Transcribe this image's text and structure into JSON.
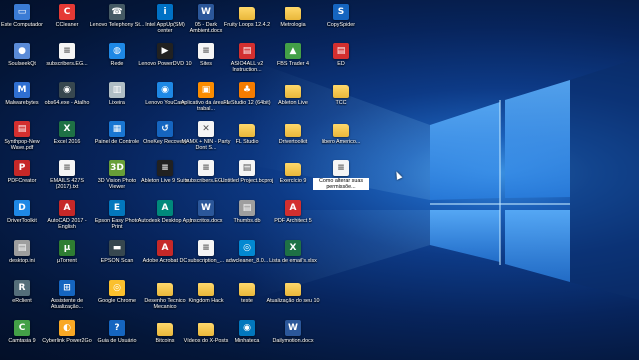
{
  "desktop": {
    "columns": [
      [
        {
          "label": "Este Computador",
          "icon": "computer-icon",
          "color": "#3a7bd5",
          "glyph": "▭"
        },
        {
          "label": "SoulseekQt",
          "icon": "soulseek-icon",
          "color": "#5a8bd8",
          "glyph": "●"
        },
        {
          "label": "Malwarebytes",
          "icon": "malwarebytes-icon",
          "color": "#2f6fd1",
          "glyph": "M"
        },
        {
          "label": "Synthpop-New Wave.pdf",
          "icon": "pdf-icon",
          "color": "#d32f2f",
          "glyph": "▤"
        },
        {
          "label": "PDFCreator",
          "icon": "pdfcreator-icon",
          "color": "#c62828",
          "glyph": "P"
        },
        {
          "label": "DriverToolkit",
          "icon": "drivertoolkit-icon",
          "color": "#1e88e5",
          "glyph": "D"
        },
        {
          "label": "desktop.ini",
          "icon": "ini-file-icon",
          "color": "#9e9e9e",
          "glyph": "▤"
        },
        {
          "label": "eRclient",
          "icon": "erclient-icon",
          "color": "#546e7a",
          "glyph": "R"
        },
        {
          "label": "Camtasia 9",
          "icon": "camtasia-icon",
          "color": "#43a047",
          "glyph": "C"
        }
      ],
      [
        {
          "label": "CCleaner",
          "icon": "ccleaner-icon",
          "color": "#e53935",
          "glyph": "C"
        },
        {
          "label": "subscribers.EG...",
          "icon": "text-file-icon",
          "color": "#eceff1",
          "glyph": "≡"
        },
        {
          "label": "obs64.exe - Atalho",
          "icon": "obs-icon",
          "color": "#37474f",
          "glyph": "◉"
        },
        {
          "label": "Excel 2016",
          "icon": "excel-icon",
          "color": "#1e7145",
          "glyph": "X"
        },
        {
          "label": "EMAILS 427S (2017).txt",
          "icon": "text-file-icon",
          "color": "#eceff1",
          "glyph": "≡"
        },
        {
          "label": "AutoCAD 2017 - English",
          "icon": "autocad-icon",
          "color": "#c62828",
          "glyph": "A"
        },
        {
          "label": "µTorrent",
          "icon": "utorrent-icon",
          "color": "#2e7d32",
          "glyph": "µ"
        },
        {
          "label": "Assistente de Atualização...",
          "icon": "windows-update-icon",
          "color": "#1565c0",
          "glyph": "⊞"
        },
        {
          "label": "Cyberlink Power2Go",
          "icon": "power2go-icon",
          "color": "#f9a825",
          "glyph": "◐"
        }
      ],
      [
        {
          "label": "Lenovo Telephony St...",
          "icon": "lenovo-telephony-icon",
          "color": "#455a64",
          "glyph": "☎"
        },
        {
          "label": "Rede",
          "icon": "network-icon",
          "color": "#1e88e5",
          "glyph": "◍"
        },
        {
          "label": "Lixeira",
          "icon": "recycle-bin-icon",
          "color": "#b0bec5",
          "glyph": "▥"
        },
        {
          "label": "Painel de Controle",
          "icon": "control-panel-icon",
          "color": "#1976d2",
          "glyph": "▦"
        },
        {
          "label": "3D Vision Photo Viewer",
          "icon": "3d-vision-icon",
          "color": "#689f38",
          "glyph": "3D"
        },
        {
          "label": "Epson Easy Photo Print",
          "icon": "epson-photo-icon",
          "color": "#0277bd",
          "glyph": "E"
        },
        {
          "label": "EPSON Scan",
          "icon": "epson-scan-icon",
          "color": "#37474f",
          "glyph": "▬"
        },
        {
          "label": "Google Chrome",
          "icon": "chrome-icon",
          "color": "#fbc02d",
          "glyph": "◎"
        },
        {
          "label": "Guia de Usuário",
          "icon": "guide-icon",
          "color": "#1565c0",
          "glyph": "?"
        }
      ],
      [
        {
          "label": "Intel AppUp(SM) center",
          "icon": "intel-appup-icon",
          "color": "#0071c5",
          "glyph": "i"
        },
        {
          "label": "Lenovo PowerDVD 10",
          "icon": "powerdvd-icon",
          "color": "#212121",
          "glyph": "▶"
        },
        {
          "label": "Lenovo YouCam",
          "icon": "youcam-icon",
          "color": "#1e88e5",
          "glyph": "◉"
        },
        {
          "label": "OneKey Recovery",
          "icon": "onekey-icon",
          "color": "#1565c0",
          "glyph": "↺"
        },
        {
          "label": "Ableton Live 9 Suite",
          "icon": "ableton-icon",
          "color": "#212121",
          "glyph": "≡"
        },
        {
          "label": "Autodesk Desktop App",
          "icon": "autodesk-icon",
          "color": "#00897b",
          "glyph": "A"
        },
        {
          "label": "Adobe Acrobat DC",
          "icon": "acrobat-icon",
          "color": "#c62828",
          "glyph": "A"
        },
        {
          "label": "Desenho Tecnico Mecanico",
          "icon": "folder-icon",
          "color": "#f4c542",
          "glyph": ""
        },
        {
          "label": "Bitcoins",
          "icon": "folder-icon",
          "color": "#f4c542",
          "glyph": ""
        }
      ],
      [
        {
          "label": "05 - Dark Ambient.docx",
          "icon": "word-doc-icon",
          "color": "#2b579a",
          "glyph": "W"
        },
        {
          "label": "Sites",
          "icon": "text-file-icon",
          "color": "#eceff1",
          "glyph": "≡"
        },
        {
          "label": "Aplicativo da área de trabal...",
          "icon": "app-icon",
          "color": "#fb8c00",
          "glyph": "▣"
        },
        {
          "label": "MAMX + NIN - Party Dont S...",
          "icon": "document-icon",
          "color": "#eceff1",
          "glyph": "✕"
        },
        {
          "label": "subscribers.EG...",
          "icon": "text-file-icon",
          "color": "#eceff1",
          "glyph": "≡"
        },
        {
          "label": "Inscritos.docx",
          "icon": "word-doc-icon",
          "color": "#2b579a",
          "glyph": "W"
        },
        {
          "label": "subscription_...",
          "icon": "text-file-icon",
          "color": "#eceff1",
          "glyph": "≡"
        },
        {
          "label": "Kingdom Hack",
          "icon": "folder-icon",
          "color": "#f4c542",
          "glyph": ""
        },
        {
          "label": "Vídeos do X-Posts",
          "icon": "folder-icon",
          "color": "#f4c542",
          "glyph": ""
        }
      ],
      [
        {
          "label": "Fruity Loops 12.4.2",
          "icon": "folder-icon",
          "color": "#f4c542",
          "glyph": ""
        },
        {
          "label": "ASIO4ALL v2 Instruction...",
          "icon": "pdf-icon",
          "color": "#d32f2f",
          "glyph": "▤"
        },
        {
          "label": "FL Studio 12 (64bit)",
          "icon": "fl-studio-icon",
          "color": "#f57c00",
          "glyph": "♣"
        },
        {
          "label": "FL Studio",
          "icon": "folder-icon",
          "color": "#f4c542",
          "glyph": ""
        },
        {
          "label": "Untitled Project.bcproj",
          "icon": "project-file-icon",
          "color": "#eceff1",
          "glyph": "▤"
        },
        {
          "label": "Thumbs.db",
          "icon": "db-file-icon",
          "color": "#9e9e9e",
          "glyph": "▤"
        },
        {
          "label": "adwcleaner_8.0...",
          "icon": "adwcleaner-icon",
          "color": "#0288d1",
          "glyph": "◎"
        },
        {
          "label": "teste",
          "icon": "folder-icon",
          "color": "#f4c542",
          "glyph": ""
        },
        {
          "label": "Minhateca",
          "icon": "minhateca-icon",
          "color": "#0277bd",
          "glyph": "◉"
        }
      ],
      [
        {
          "label": "Metrologia",
          "icon": "folder-icon",
          "color": "#f4c542",
          "glyph": ""
        },
        {
          "label": "FBS Trader 4",
          "icon": "fbs-trader-icon",
          "color": "#43a047",
          "glyph": "▲"
        },
        {
          "label": "Ableton Live",
          "icon": "folder-icon",
          "color": "#f4c542",
          "glyph": ""
        },
        {
          "label": "Drivertoolkit",
          "icon": "folder-icon",
          "color": "#f4c542",
          "glyph": ""
        },
        {
          "label": "Exercício 9",
          "icon": "folder-icon",
          "color": "#f4c542",
          "glyph": ""
        },
        {
          "label": "PDF Architect 5",
          "icon": "pdf-architect-icon",
          "color": "#d32f2f",
          "glyph": "A"
        },
        {
          "label": "Lista de email's.xlsx",
          "icon": "excel-file-icon",
          "color": "#1e7145",
          "glyph": "X"
        },
        {
          "label": "Atualização do seu 10",
          "icon": "folder-icon",
          "color": "#f4c542",
          "glyph": ""
        },
        {
          "label": "Dailymotion.docx",
          "icon": "word-doc-icon",
          "color": "#2b579a",
          "glyph": "W"
        }
      ],
      [
        {
          "label": "CopySpider",
          "icon": "copyspider-icon",
          "color": "#1565c0",
          "glyph": "S"
        },
        {
          "label": "ED",
          "icon": "pdf-icon",
          "color": "#d32f2f",
          "glyph": "▤"
        },
        {
          "label": "TCC",
          "icon": "folder-icon",
          "color": "#f4c542",
          "glyph": ""
        },
        {
          "label": "libero Americo...",
          "icon": "folder-icon",
          "color": "#f4c542",
          "glyph": ""
        },
        {
          "label": "Como alterar suas permissõe...",
          "icon": "text-file-icon",
          "color": "#eceff1",
          "glyph": "≡",
          "selected": true
        }
      ]
    ]
  }
}
